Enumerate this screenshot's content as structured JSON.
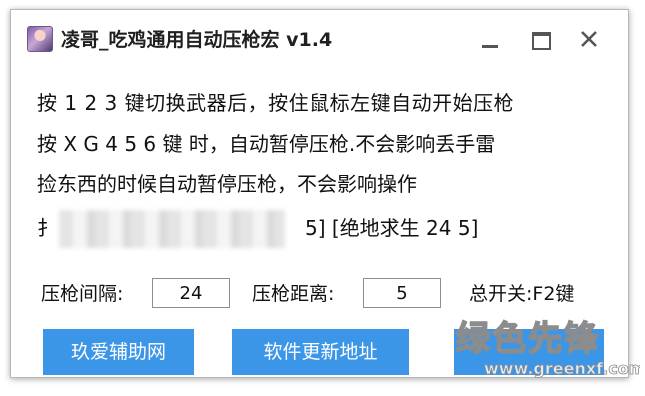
{
  "window": {
    "title": "凌哥_吃鸡通用自动压枪宏 v1.4",
    "icon": "app-avatar-icon"
  },
  "title_controls": {
    "minimize_icon": "minimize-icon",
    "maximize_icon": "maximize-icon",
    "close_icon": "close-icon"
  },
  "instructions": {
    "line1": "按 1 2 3 键切换武器后，按住鼠标左键自动开始压枪",
    "line2": "按 X  G  4  5  6 键 时，自动暂停压枪.不会影响丢手雷",
    "line3": "捡东西的时候自动暂停压枪，不会影响操作",
    "line4_start": "扌",
    "line4_end": "5]    [绝地求生 24   5]"
  },
  "settings": {
    "interval_label": "压枪间隔:",
    "interval_value": "24",
    "distance_label": "压枪距离:",
    "distance_value": "5",
    "switch_label": "总开关:F2键"
  },
  "buttons": {
    "site_label": "玖爱辅助网",
    "update_label": "软件更新地址"
  },
  "watermark": {
    "text_cn": "绿色先锋",
    "text_url": "www.greenxf.com"
  },
  "colors": {
    "button_bg": "#3b96e8",
    "button_text": "#ffffff",
    "text": "#111111"
  }
}
